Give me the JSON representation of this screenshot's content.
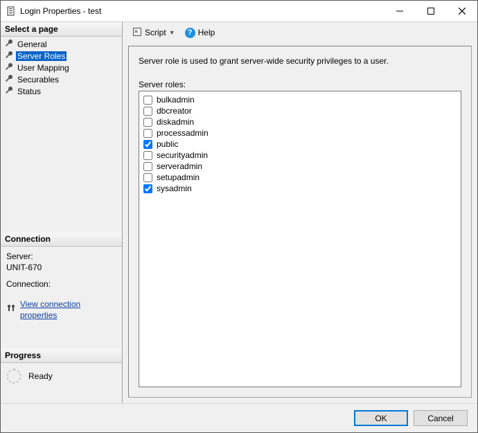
{
  "window": {
    "title": "Login Properties - test"
  },
  "sidebar": {
    "select_page": "Select a page",
    "pages": [
      {
        "label": "General"
      },
      {
        "label": "Server Roles",
        "selected": true
      },
      {
        "label": "User Mapping"
      },
      {
        "label": "Securables"
      },
      {
        "label": "Status"
      }
    ],
    "connection": {
      "heading": "Connection",
      "server_label": "Server:",
      "server_value": "UNIT-670",
      "connection_label": "Connection:",
      "connection_value": "",
      "view_link": "View connection properties"
    },
    "progress": {
      "heading": "Progress",
      "status": "Ready"
    }
  },
  "toolbar": {
    "script": "Script",
    "help": "Help"
  },
  "content": {
    "description": "Server role is used to grant server-wide security privileges to a user.",
    "roles_label": "Server roles:",
    "roles": [
      {
        "name": "bulkadmin",
        "checked": false
      },
      {
        "name": "dbcreator",
        "checked": false
      },
      {
        "name": "diskadmin",
        "checked": false
      },
      {
        "name": "processadmin",
        "checked": false
      },
      {
        "name": "public",
        "checked": true
      },
      {
        "name": "securityadmin",
        "checked": false
      },
      {
        "name": "serveradmin",
        "checked": false
      },
      {
        "name": "setupadmin",
        "checked": false
      },
      {
        "name": "sysadmin",
        "checked": true
      }
    ]
  },
  "footer": {
    "ok": "OK",
    "cancel": "Cancel"
  }
}
